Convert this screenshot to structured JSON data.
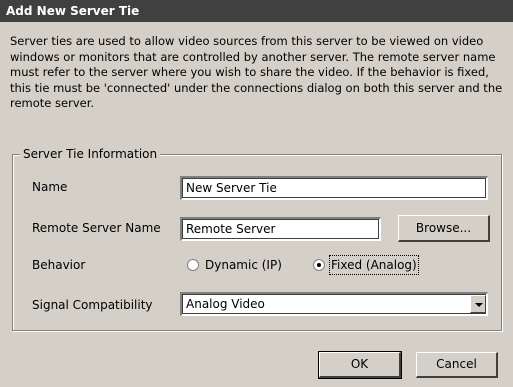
{
  "dialog": {
    "title": "Add New Server Tie",
    "description": "Server ties are used to allow video sources from this server to be viewed on video windows or monitors that are controlled by another server.  The remote server name must refer to the server where you wish to share the video.  If the behavior is fixed, this tie must be 'connected' under the connections dialog on both this server and the remote server."
  },
  "group": {
    "legend": "Server Tie Information"
  },
  "fields": {
    "name_label": "Name",
    "name_value": "New Server Tie",
    "remote_label": "Remote Server Name",
    "remote_value": "Remote Server",
    "browse_label": "Browse...",
    "behavior_label": "Behavior",
    "behavior_options": [
      {
        "label": "Dynamic (IP)",
        "selected": false
      },
      {
        "label": "Fixed (Analog)",
        "selected": true
      }
    ],
    "signal_label": "Signal Compatibility",
    "signal_value": "Analog Video"
  },
  "buttons": {
    "ok": "OK",
    "cancel": "Cancel"
  }
}
